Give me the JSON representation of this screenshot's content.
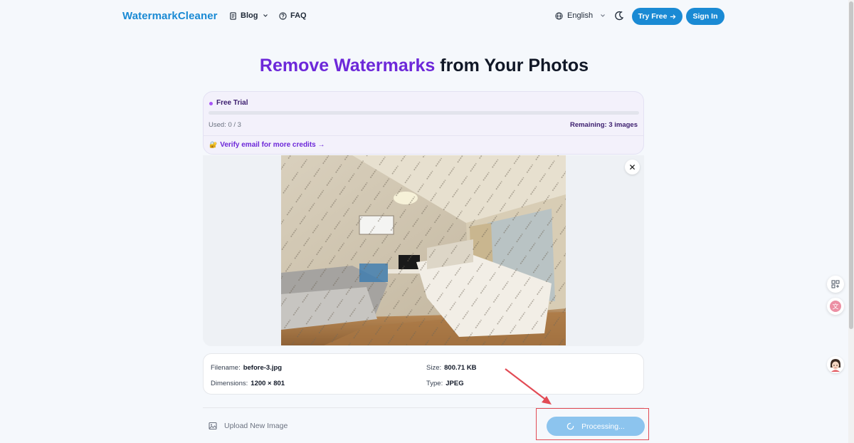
{
  "header": {
    "logo": "WatermarkCleaner",
    "nav": [
      {
        "label": "Blog",
        "icon": "document-icon"
      },
      {
        "label": "FAQ",
        "icon": "help-circle-icon"
      }
    ],
    "language": "English",
    "try_free": "Try Free",
    "sign_in": "Sign In"
  },
  "hero": {
    "title_accent": "Remove Watermarks",
    "title_rest": "from Your Photos"
  },
  "trial": {
    "label": "Free Trial",
    "used": "Used: 0 / 3",
    "remaining": "Remaining: 3 images",
    "used_fraction": 0,
    "verify": "Verify email for more credits →"
  },
  "image": {
    "close_symbol": "✕"
  },
  "file_info": {
    "filename_label": "Filename:",
    "filename": "before-3.jpg",
    "size_label": "Size:",
    "size": "800.71 KB",
    "dimensions_label": "Dimensions:",
    "dimensions": "1200 × 801",
    "type_label": "Type:",
    "type": "JPEG"
  },
  "actions": {
    "upload": "Upload New Image",
    "processing": "Processing..."
  },
  "colors": {
    "accent": "#1a8ad4",
    "purple": "#6d28d9",
    "annotation": "#e24b55"
  }
}
